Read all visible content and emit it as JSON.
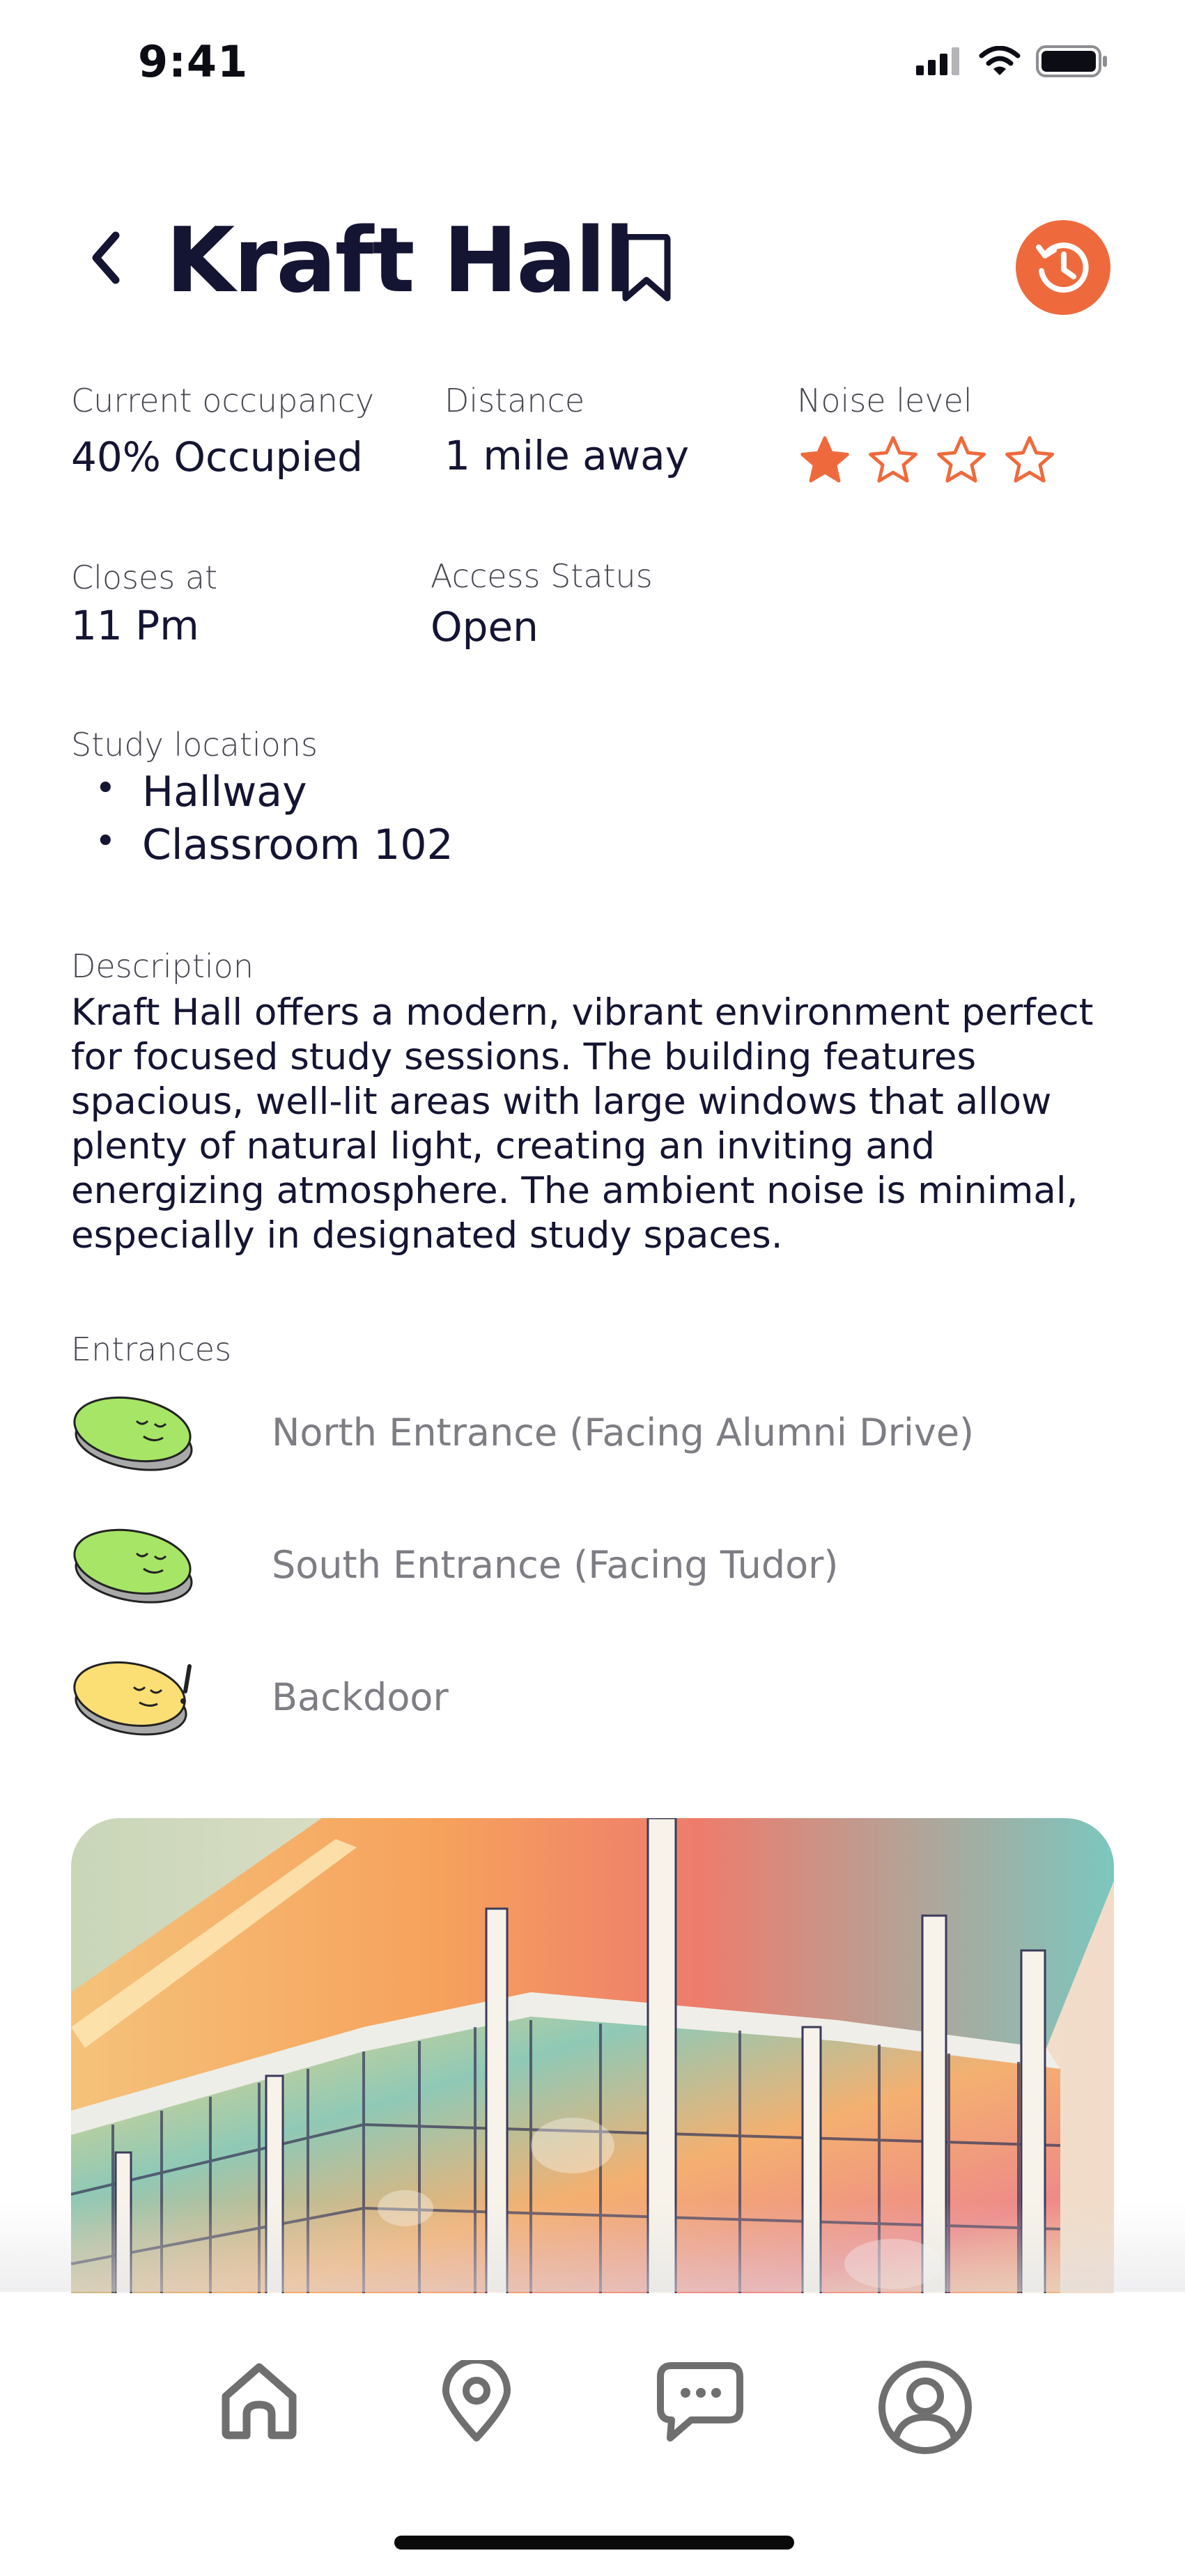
{
  "status_bar": {
    "time": "9:41"
  },
  "header": {
    "title": "Kraft Hall"
  },
  "colors": {
    "accent": "#ee6a3d",
    "text": "#141433",
    "muted_text": "#7d7d84"
  },
  "info": {
    "occupancy": {
      "label": "Current occupancy",
      "value": "40% Occupied"
    },
    "distance": {
      "label": "Distance",
      "value": "1 mile away"
    },
    "noise": {
      "label": "Noise level",
      "rating": 1,
      "max": 5
    },
    "closes": {
      "label": "Closes at",
      "value": "11 Pm"
    },
    "access": {
      "label": "Access Status",
      "value": "Open"
    }
  },
  "study_locations": {
    "label": "Study locations",
    "items": [
      "Hallway",
      "Classroom 102"
    ]
  },
  "description": {
    "label": "Description",
    "text": "Kraft Hall offers a modern, vibrant environment perfect for focused  study sessions. The building features spacious, well-lit areas with large windows that allow plenty of natural light, creating an inviting and energizing atmosphere. The ambient noise is minimal, especially in designated study spaces."
  },
  "entrances": {
    "label": "Entrances",
    "items": [
      {
        "name": "North Entrance (Facing Alumni Drive)",
        "status_icon": "sleepy-green-icon"
      },
      {
        "name": "South Entrance (Facing Tudor)",
        "status_icon": "sleepy-green-icon"
      },
      {
        "name": "Backdoor",
        "status_icon": "sleepy-yellow-alert-icon"
      }
    ]
  },
  "tabbar": {
    "items": [
      {
        "icon": "home-icon"
      },
      {
        "icon": "location-pin-icon"
      },
      {
        "icon": "chat-icon"
      },
      {
        "icon": "profile-icon"
      }
    ]
  }
}
